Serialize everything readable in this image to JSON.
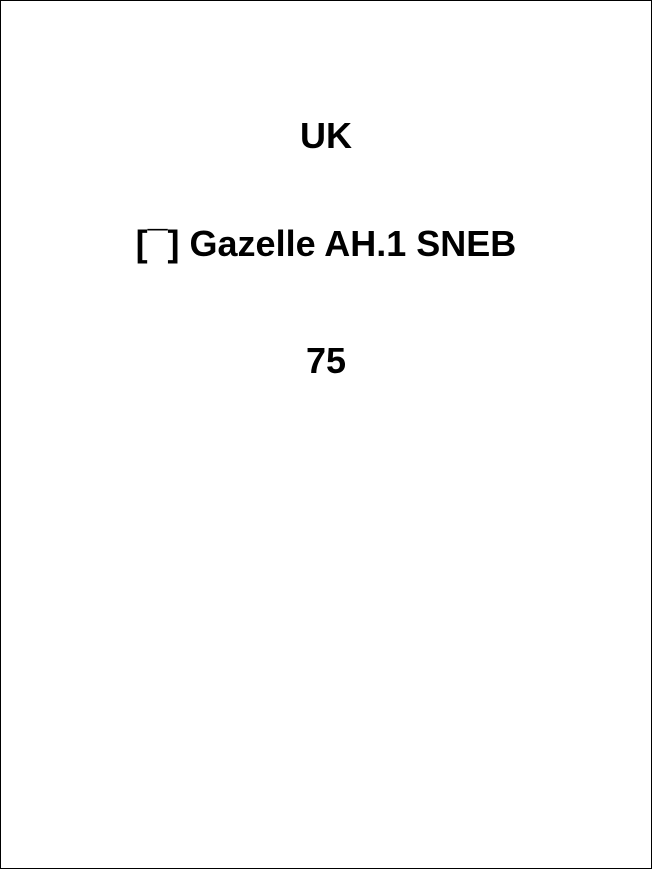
{
  "card": {
    "country": "UK",
    "aircraft": "[¯] Gazelle AH.1 SNEB",
    "count": "75"
  }
}
